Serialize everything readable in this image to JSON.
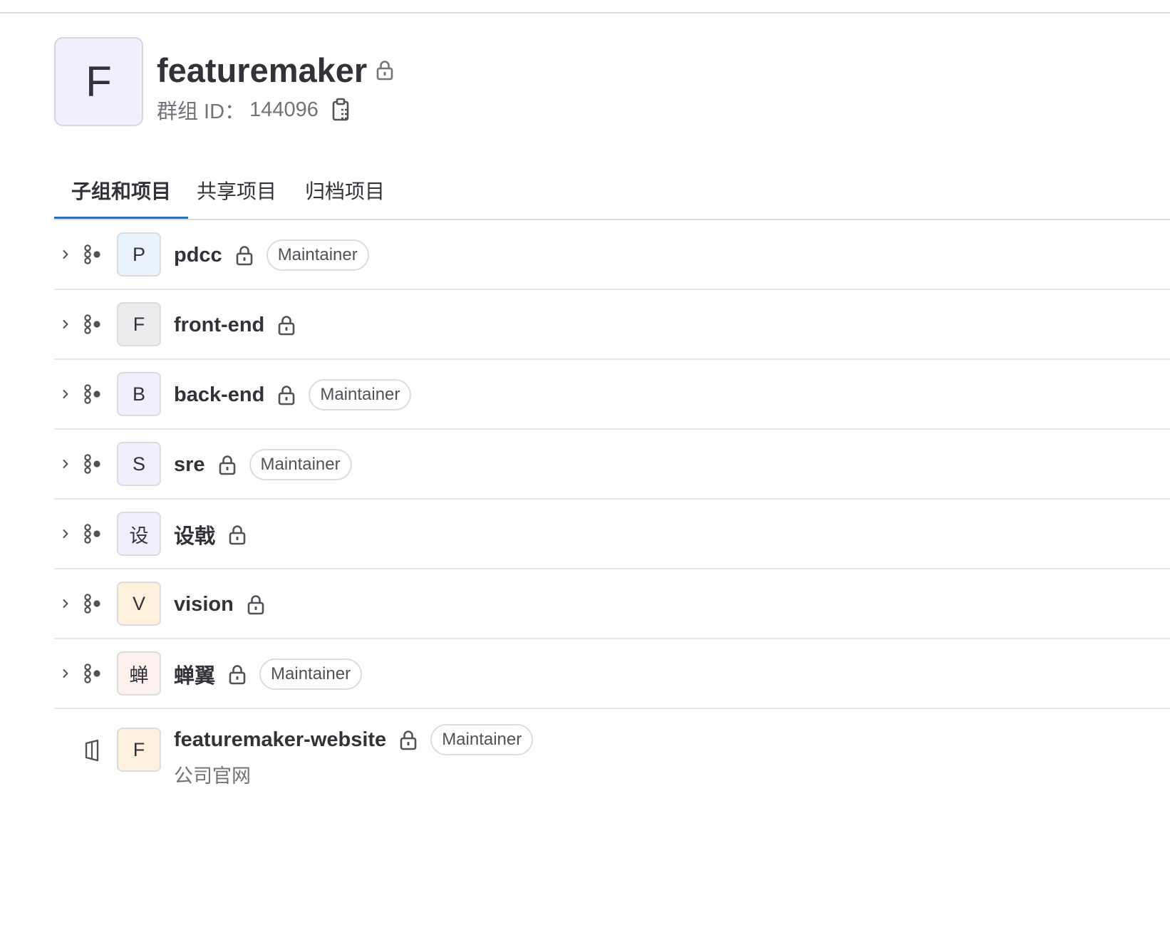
{
  "group": {
    "avatar_letter": "F",
    "name": "featuremaker",
    "id_label": "群组 ID：",
    "id_value": "144096",
    "visibility_icon": "lock-icon",
    "copy_icon": "copy-to-clipboard-icon"
  },
  "tabs": [
    {
      "label": "子组和项目",
      "active": true
    },
    {
      "label": "共享项目",
      "active": false
    },
    {
      "label": "归档项目",
      "active": false
    }
  ],
  "colors": {
    "accent": "#1f75cb",
    "text": "#333238",
    "muted": "#737278",
    "border": "#dcdcde"
  },
  "items": [
    {
      "type": "subgroup",
      "avatar": "P",
      "avatar_bg": "#e9f3fc",
      "name": "pdcc",
      "role": "Maintainer"
    },
    {
      "type": "subgroup",
      "avatar": "F",
      "avatar_bg": "#ececef",
      "name": "front-end",
      "role": ""
    },
    {
      "type": "subgroup",
      "avatar": "B",
      "avatar_bg": "#f1effc",
      "name": "back-end",
      "role": "Maintainer"
    },
    {
      "type": "subgroup",
      "avatar": "S",
      "avatar_bg": "#f1effc",
      "name": "sre",
      "role": "Maintainer"
    },
    {
      "type": "subgroup",
      "avatar": "设",
      "avatar_bg": "#f1effc",
      "name": "设戟",
      "role": ""
    },
    {
      "type": "subgroup",
      "avatar": "V",
      "avatar_bg": "#fdf1dd",
      "name": "vision",
      "role": ""
    },
    {
      "type": "subgroup",
      "avatar": "蝉",
      "avatar_bg": "#fcf1ef",
      "name": "蝉翼",
      "role": "Maintainer"
    },
    {
      "type": "project",
      "avatar": "F",
      "avatar_bg": "#fdf1dd",
      "name": "featuremaker-website",
      "role": "Maintainer",
      "description": "公司官网"
    }
  ]
}
